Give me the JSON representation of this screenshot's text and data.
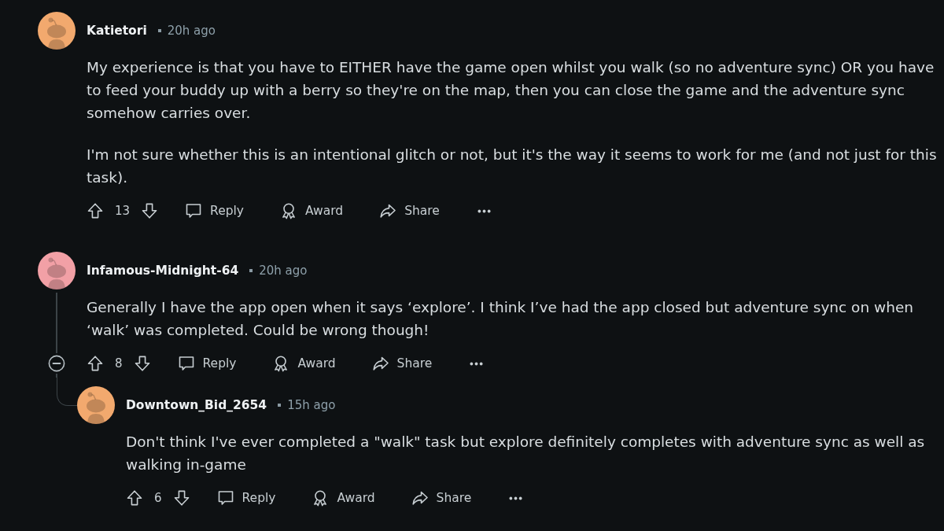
{
  "comments": [
    {
      "author": "Katietori",
      "time": "20h ago",
      "color": "#f2a96e",
      "paragraphs": [
        "My experience is that you have to EITHER have the game open whilst you walk (so no adventure sync) OR you have to feed your buddy up with a berry so they're on the map, then you can close the game and the adventure sync somehow carries over.",
        "I'm not sure whether this is an intentional glitch or not, but it's the way it seems to work for me (and not just for this task)."
      ],
      "score": "13",
      "actions": [
        {
          "kind": "reply",
          "label": "Reply"
        },
        {
          "kind": "award",
          "label": "Award"
        },
        {
          "kind": "share",
          "label": "Share"
        }
      ]
    },
    {
      "author": "Infamous-Midnight-64",
      "time": "20h ago",
      "color": "#f2a0a6",
      "paragraphs": [
        "Generally I have the app open when it says ‘explore’. I think I’ve had the app closed but adventure sync on when ‘walk’ was completed. Could be wrong though!"
      ],
      "score": "8",
      "actions": [
        {
          "kind": "reply",
          "label": "Reply"
        },
        {
          "kind": "award",
          "label": "Award"
        },
        {
          "kind": "share",
          "label": "Share"
        }
      ],
      "expanded": true,
      "replies": [
        {
          "author": "Downtown_Bid_2654",
          "time": "15h ago",
          "color": "#f2a96e",
          "paragraphs": [
            "Don't think I've ever completed a \"walk\" task but explore definitely completes with adventure sync as well as walking in-game"
          ],
          "score": "6",
          "actions": [
            {
              "kind": "reply",
              "label": "Reply"
            },
            {
              "kind": "award",
              "label": "Award"
            },
            {
              "kind": "share",
              "label": "Share"
            }
          ]
        }
      ]
    }
  ]
}
